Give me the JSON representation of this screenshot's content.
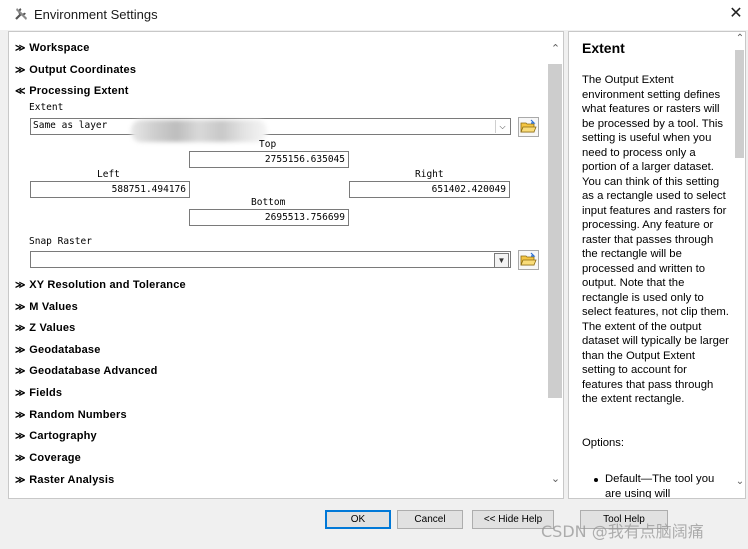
{
  "window": {
    "title": "Environment Settings",
    "close_label": "✕"
  },
  "sections_top": [
    {
      "label": "Workspace",
      "chevron": "≫"
    },
    {
      "label": "Output Coordinates",
      "chevron": "≫"
    },
    {
      "label": "Processing Extent",
      "chevron": "≪"
    }
  ],
  "extent": {
    "label": "Extent",
    "combo_value": "Same as layer",
    "top_label": "Top",
    "top_value": "2755156.635045",
    "left_label": "Left",
    "left_value": "588751.494176",
    "right_label": "Right",
    "right_value": "651402.420049",
    "bottom_label": "Bottom",
    "bottom_value": "2695513.756699",
    "snap_label": "Snap Raster",
    "snap_value": ""
  },
  "sections_bottom": [
    {
      "label": "XY Resolution and Tolerance",
      "chevron": "≫"
    },
    {
      "label": "M Values",
      "chevron": "≫"
    },
    {
      "label": "Z Values",
      "chevron": "≫"
    },
    {
      "label": "Geodatabase",
      "chevron": "≫"
    },
    {
      "label": "Geodatabase Advanced",
      "chevron": "≫"
    },
    {
      "label": "Fields",
      "chevron": "≫"
    },
    {
      "label": "Random Numbers",
      "chevron": "≫"
    },
    {
      "label": "Cartography",
      "chevron": "≫"
    },
    {
      "label": "Coverage",
      "chevron": "≫"
    },
    {
      "label": "Raster Analysis",
      "chevron": "≫"
    }
  ],
  "help": {
    "title": "Extent",
    "body": "The Output Extent environment setting defines what features or rasters will be processed by a tool. This setting is useful when you need to process only a portion of a larger dataset. You can think of this setting as a rectangle used to select input features and rasters for processing. Any feature or raster that passes through the rectangle will be processed and written to output. Note that the rectangle is used only to select features, not clip them. The extent of the output dataset will typically be larger than the Output Extent setting to account for features that pass through the extent rectangle.",
    "options_label": "Options:",
    "bullet": "Default—The tool you are using will"
  },
  "buttons": {
    "ok": "OK",
    "cancel": "Cancel",
    "hide_help": "<< Hide Help",
    "tool_help": "Tool Help"
  },
  "watermark": "CSDN @我有点脑阔痛"
}
